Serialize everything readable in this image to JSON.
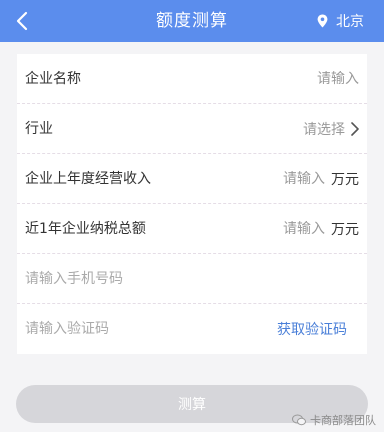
{
  "header": {
    "title": "额度测算",
    "location": "北京"
  },
  "form": {
    "company_name": {
      "label": "企业名称",
      "placeholder": "请输入"
    },
    "industry": {
      "label": "行业",
      "hint": "请选择"
    },
    "revenue": {
      "label": "企业上年度经营收入",
      "placeholder": "请输入",
      "unit": "万元"
    },
    "tax": {
      "label": "近1年企业纳税总额",
      "placeholder": "请输入",
      "unit": "万元"
    },
    "phone": {
      "placeholder": "请输入手机号码"
    },
    "code": {
      "placeholder": "请输入验证码",
      "action": "获取验证码"
    }
  },
  "submit_label": "测算",
  "watermark": "卡商部落团队",
  "colors": {
    "header": "#5b8ded",
    "link": "#4a7fd8",
    "button_disabled": "#d6d6da"
  }
}
